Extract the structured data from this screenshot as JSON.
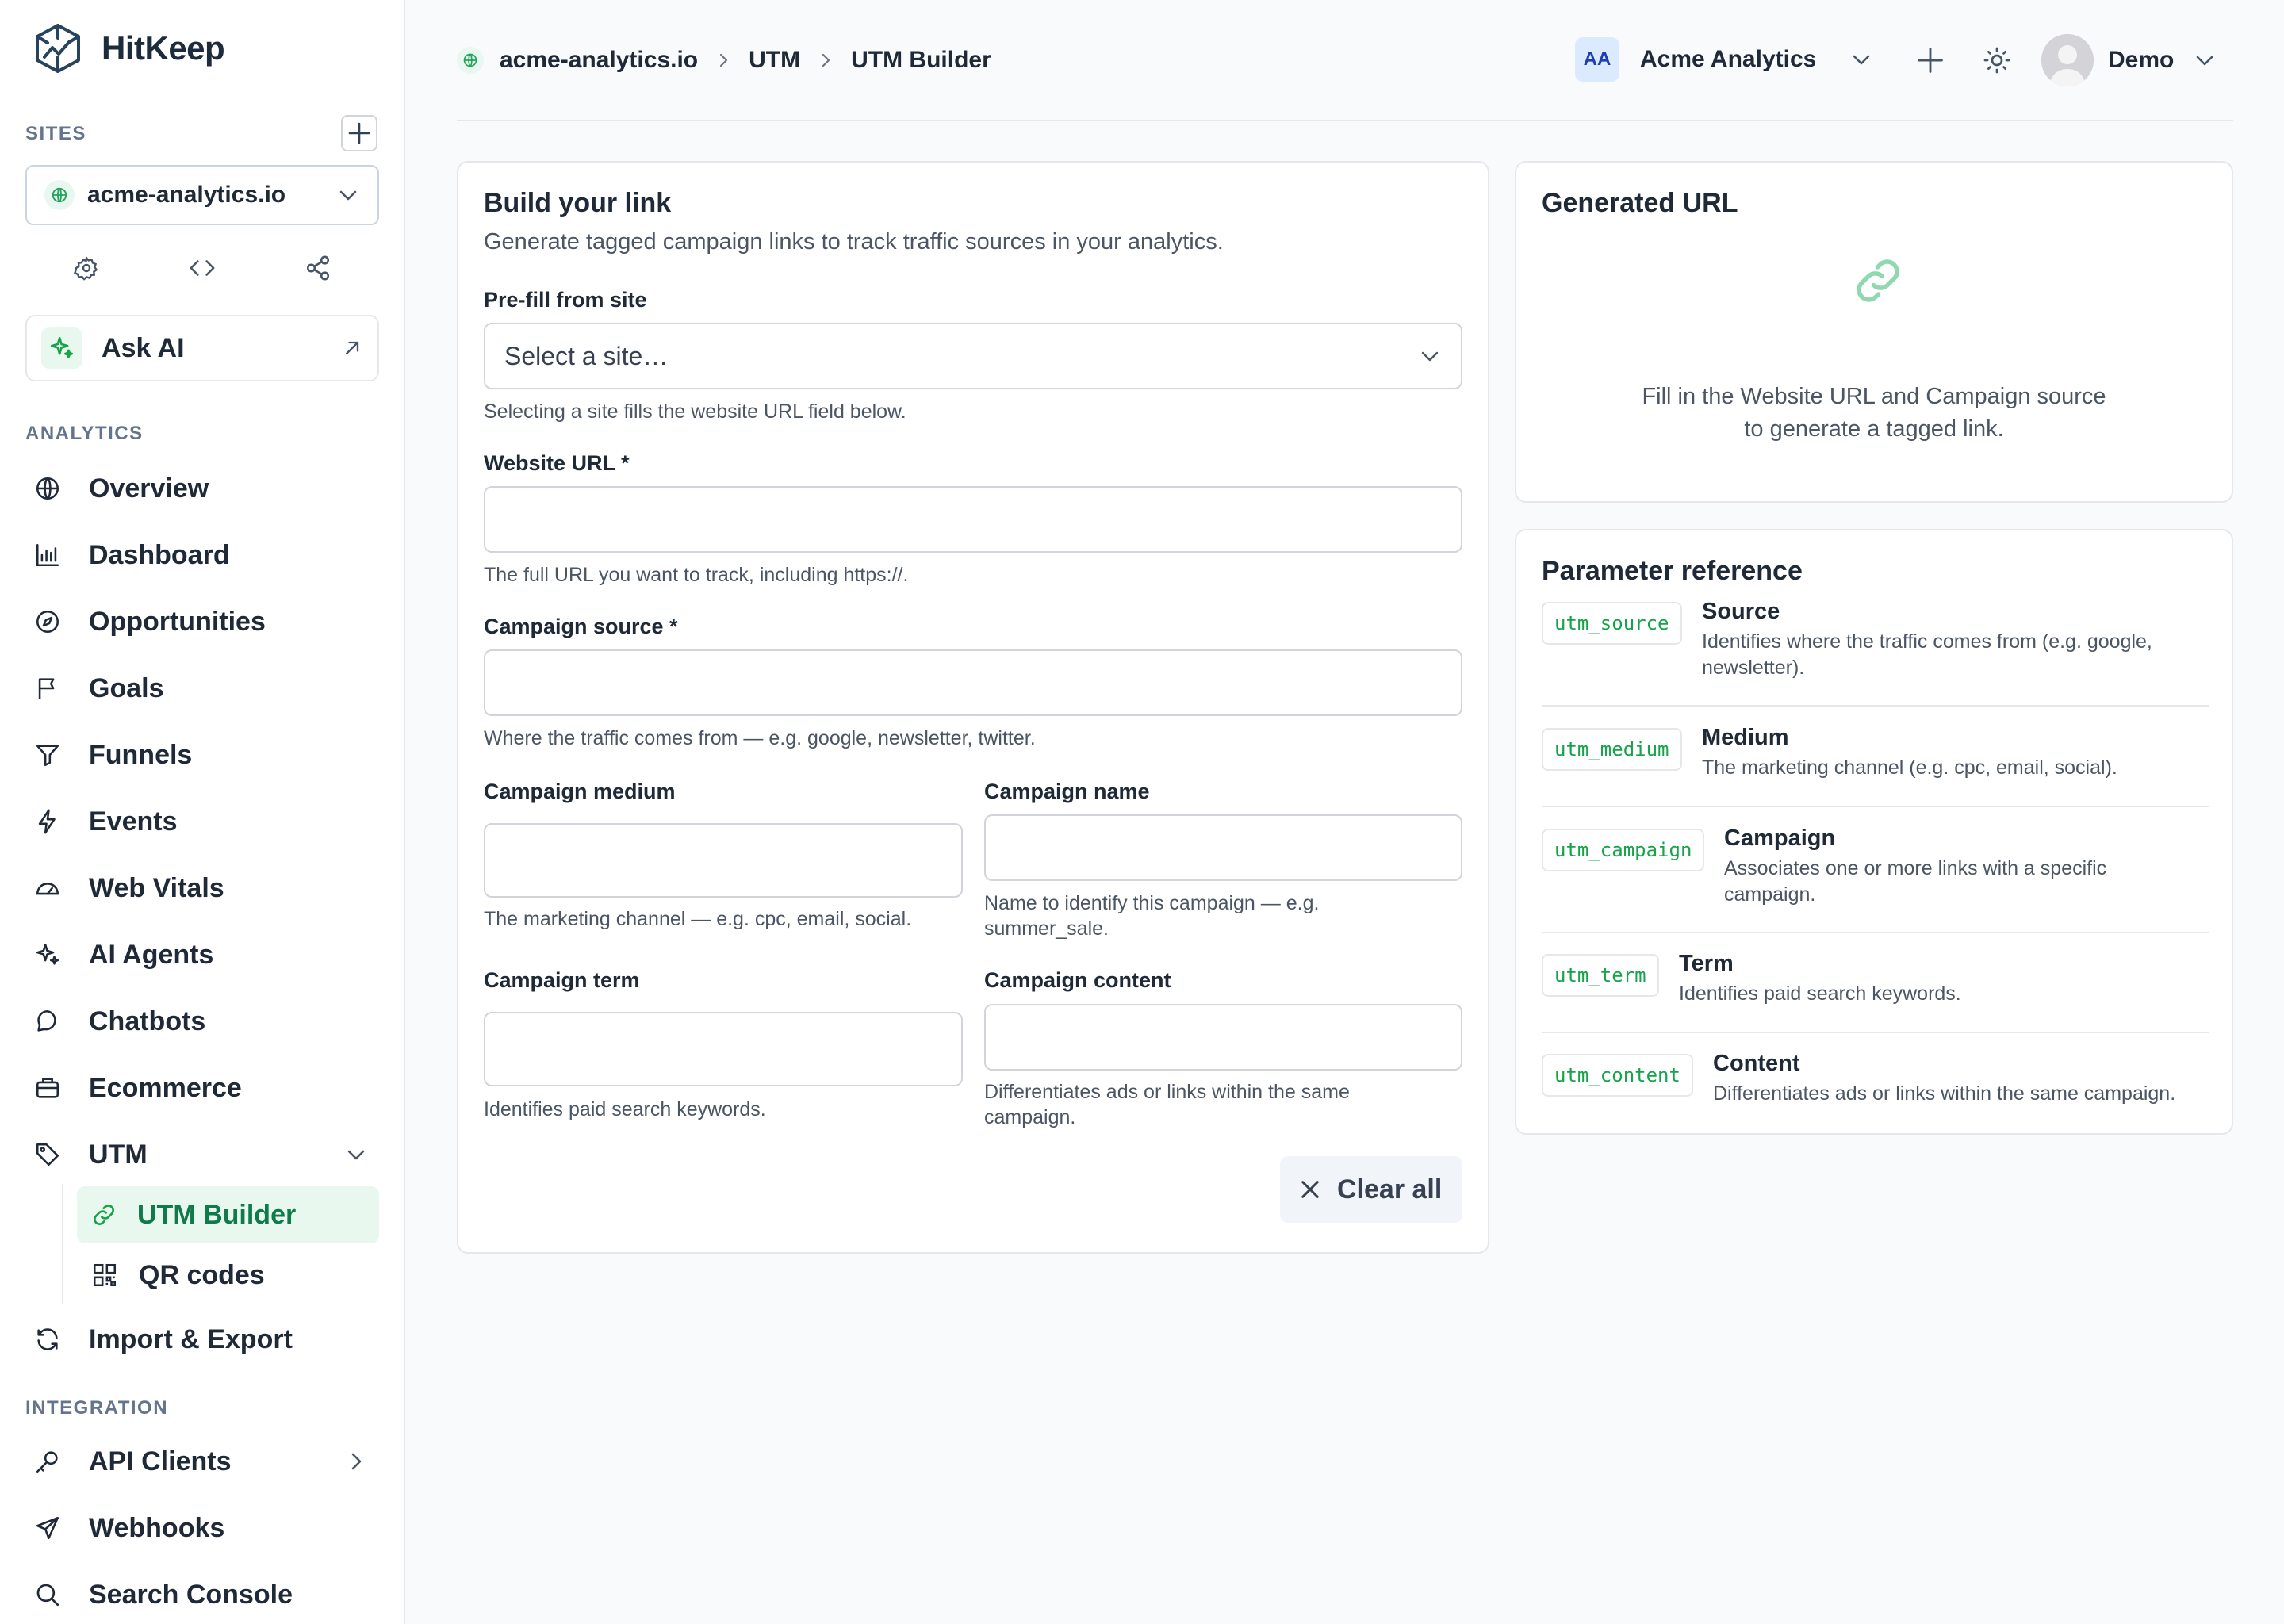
{
  "brand": {
    "name": "HitKeep"
  },
  "sidebar": {
    "sites_label": "SITES",
    "site": "acme-analytics.io",
    "ask_ai": "Ask AI",
    "analytics_label": "ANALYTICS",
    "nav": [
      {
        "label": "Overview",
        "icon": "globe-icon"
      },
      {
        "label": "Dashboard",
        "icon": "bar-chart-icon"
      },
      {
        "label": "Opportunities",
        "icon": "compass-icon"
      },
      {
        "label": "Goals",
        "icon": "flag-icon"
      },
      {
        "label": "Funnels",
        "icon": "filter-icon"
      },
      {
        "label": "Events",
        "icon": "bolt-icon"
      },
      {
        "label": "Web Vitals",
        "icon": "gauge-icon"
      },
      {
        "label": "AI Agents",
        "icon": "sparkles-icon"
      },
      {
        "label": "Chatbots",
        "icon": "chat-icon"
      },
      {
        "label": "Ecommerce",
        "icon": "briefcase-icon"
      },
      {
        "label": "UTM",
        "icon": "tag-icon"
      }
    ],
    "utm_sub": [
      {
        "label": "UTM Builder",
        "icon": "link-icon",
        "active": true
      },
      {
        "label": "QR codes",
        "icon": "qr-icon",
        "active": false
      }
    ],
    "import_export": "Import & Export",
    "integration_label": "INTEGRATION",
    "integration": [
      {
        "label": "API Clients",
        "icon": "key-icon"
      },
      {
        "label": "Webhooks",
        "icon": "send-icon"
      },
      {
        "label": "Search Console",
        "icon": "search-icon"
      }
    ]
  },
  "header": {
    "breadcrumbs": [
      "acme-analytics.io",
      "UTM",
      "UTM Builder"
    ],
    "org_initials": "AA",
    "org_name": "Acme Analytics",
    "user_name": "Demo"
  },
  "builder": {
    "title": "Build your link",
    "subtitle": "Generate tagged campaign links to track traffic sources in your analytics.",
    "prefill_label": "Pre-fill from site",
    "prefill_placeholder": "Select a site…",
    "prefill_hint": "Selecting a site fills the website URL field below.",
    "website_label": "Website URL *",
    "website_value": "",
    "website_hint": "The full URL you want to track, including https://.",
    "source_label": "Campaign source *",
    "source_value": "",
    "source_hint": "Where the traffic comes from — e.g. google, newsletter, twitter.",
    "medium_label": "Campaign medium",
    "medium_value": "",
    "medium_hint": "The marketing channel — e.g. cpc, email, social.",
    "name_label": "Campaign name",
    "name_value": "",
    "name_hint_1": "Name to identify this campaign — e.g.",
    "name_hint_2": "summer_sale.",
    "term_label": "Campaign term",
    "term_value": "",
    "term_hint": "Identifies paid search keywords.",
    "content_label": "Campaign content",
    "content_value": "",
    "content_hint_1": "Differentiates ads or links within the same",
    "content_hint_2": "campaign.",
    "clear_label": "Clear all"
  },
  "generated": {
    "title": "Generated URL",
    "empty_1": "Fill in the Website URL and Campaign source",
    "empty_2": "to generate a tagged link."
  },
  "reference": {
    "title": "Parameter reference",
    "rows": [
      {
        "code": "utm_source",
        "name": "Source",
        "desc_1": "Identifies where the traffic comes from (e.g. google,",
        "desc_2": "newsletter)."
      },
      {
        "code": "utm_medium",
        "name": "Medium",
        "desc_1": "The marketing channel (e.g. cpc, email, social).",
        "desc_2": ""
      },
      {
        "code": "utm_campaign",
        "name": "Campaign",
        "desc_1": "Associates one or more links with a specific",
        "desc_2": "campaign."
      },
      {
        "code": "utm_term",
        "name": "Term",
        "desc_1": "Identifies paid search keywords.",
        "desc_2": ""
      },
      {
        "code": "utm_content",
        "name": "Content",
        "desc_1": "Differentiates ads or links within the same campaign.",
        "desc_2": ""
      }
    ]
  },
  "colors": {
    "accent": "#16a34a",
    "accent_bg": "#e9f8ef",
    "text": "#1f2937",
    "muted": "#4b5563",
    "border": "#e5e7eb"
  }
}
